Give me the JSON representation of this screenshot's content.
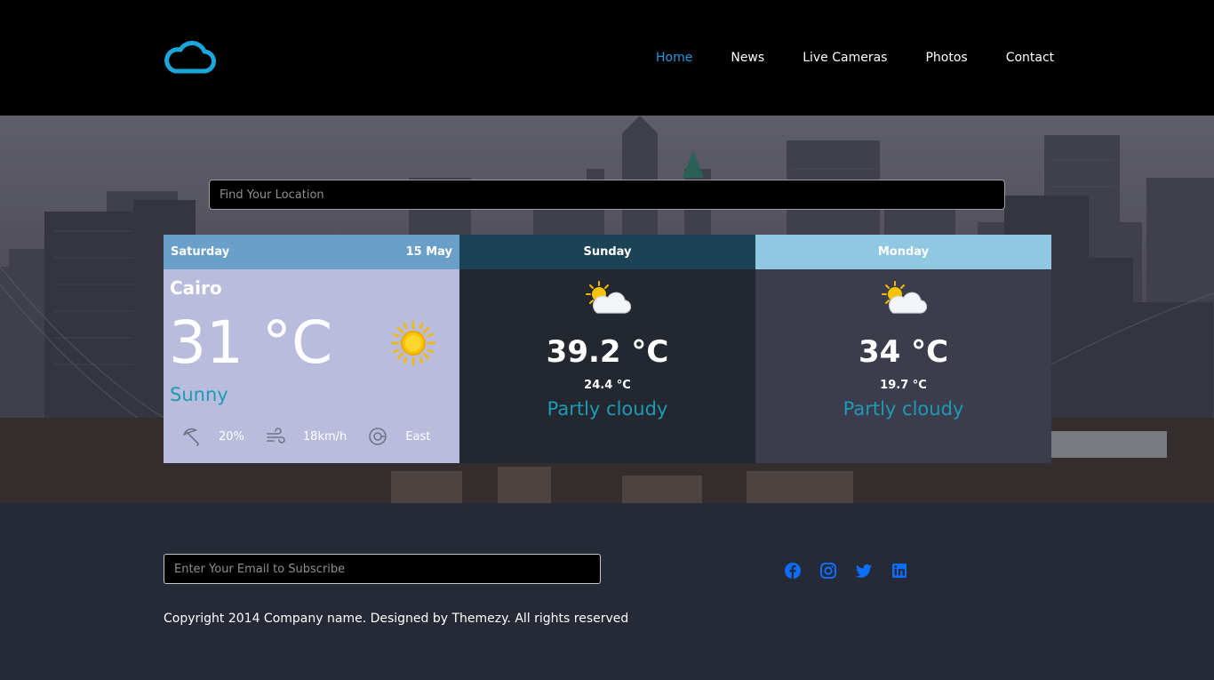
{
  "nav": {
    "items": [
      {
        "label": "Home",
        "active": true
      },
      {
        "label": "News",
        "active": false
      },
      {
        "label": "Live Cameras",
        "active": false
      },
      {
        "label": "Photos",
        "active": false
      },
      {
        "label": "Contact",
        "active": false
      }
    ]
  },
  "search": {
    "placeholder": "Find Your Location"
  },
  "today": {
    "day": "Saturday",
    "date": "15 May",
    "city": "Cairo",
    "temp": "31 °C",
    "condition": "Sunny",
    "icon": "sun-icon",
    "rain": "20%",
    "wind": "18km/h",
    "direction": "East"
  },
  "forecast": [
    {
      "day": "Sunday",
      "max": "39.2 °C",
      "min": "24.4 °C",
      "condition": "Partly cloudy",
      "icon": "partly-cloudy-icon"
    },
    {
      "day": "Monday",
      "max": "34 °C",
      "min": "19.7 °C",
      "condition": "Partly cloudy",
      "icon": "partly-cloudy-icon"
    }
  ],
  "footer": {
    "subscribe_placeholder": "Enter Your Email to Subscribe",
    "copyright": "Copyright 2014 Company name. Designed by Themezy. All rights reserved",
    "social": [
      "facebook-icon",
      "instagram-icon",
      "twitter-icon",
      "linkedin-icon"
    ]
  },
  "colors": {
    "accent": "#1d9bd8",
    "condition_text": "#1d9bb5",
    "social_blue": "#0d6efd",
    "header_bg": "#000000",
    "footer_bg": "#262936"
  }
}
